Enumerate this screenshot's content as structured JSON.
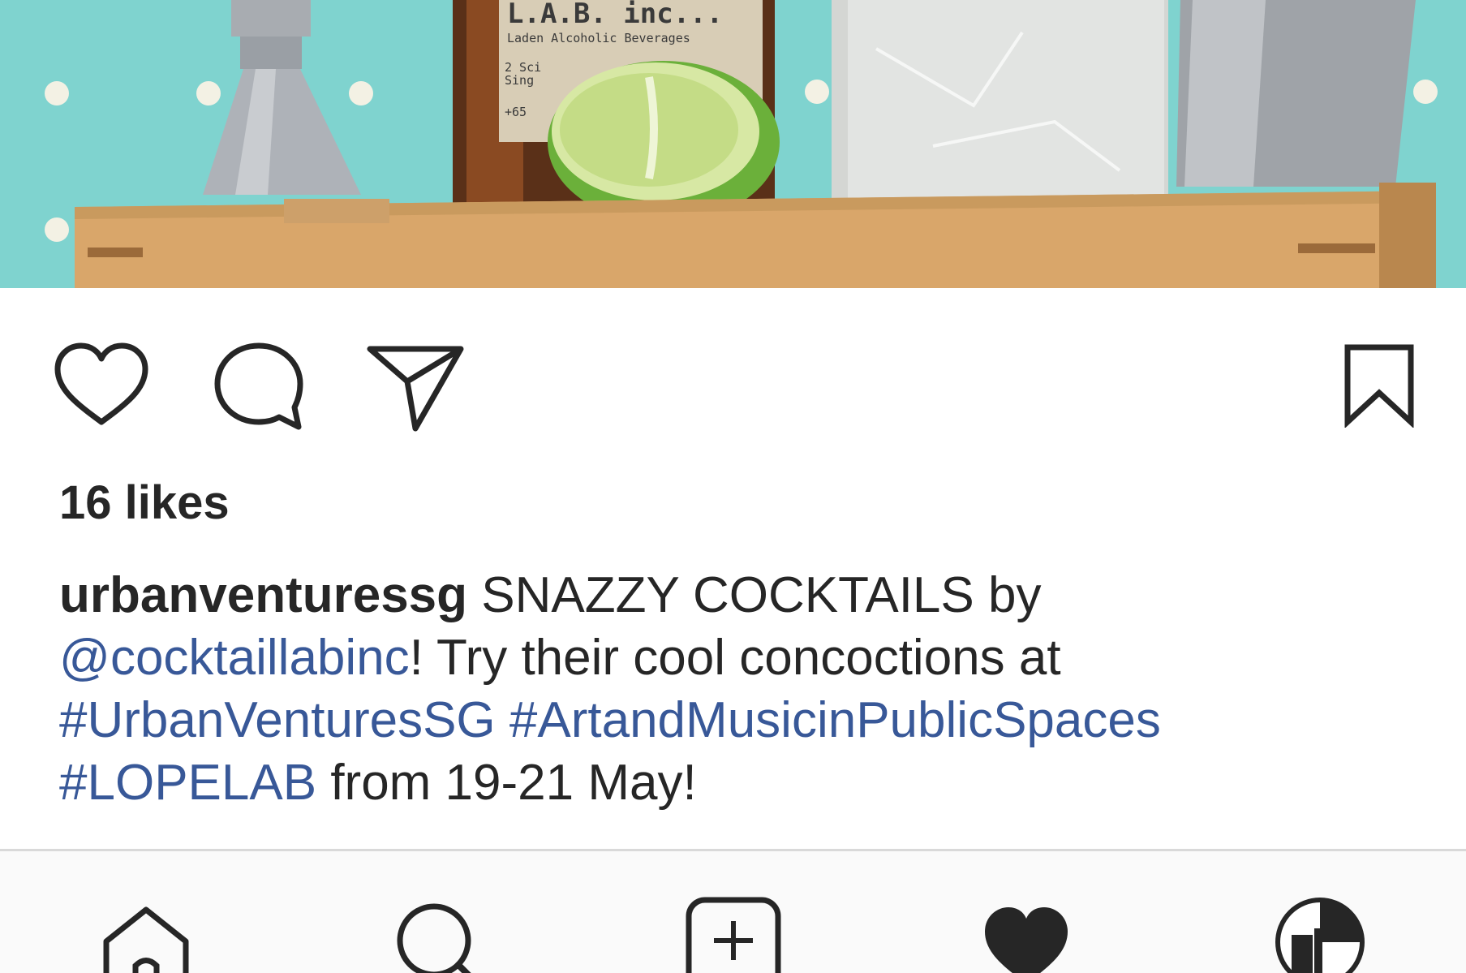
{
  "post": {
    "image": {
      "description_icon": "cocktail-product-photo",
      "bottle_label_title": "L.A.B. inc...",
      "bottle_label_subtitle": "Laden Alcoholic Beverages",
      "bottle_label_line3": "2 Sci",
      "bottle_label_line4": "Sing",
      "bottle_label_line5": "+65",
      "background_color": "#7fd3cf"
    },
    "actions": {
      "like_icon": "heart-outline-icon",
      "comment_icon": "speech-bubble-icon",
      "share_icon": "paper-plane-icon",
      "save_icon": "bookmark-icon"
    },
    "likes": "16 likes",
    "caption": {
      "username": "urbanventuressg",
      "text_1": " SNAZZY COCKTAILS by ",
      "mention": "@cocktaillabinc",
      "text_2": "! Try their cool concoctions at ",
      "hashtag_1": "#UrbanVenturesSG",
      "hashtag_2": "#ArtandMusicinPublicSpaces",
      "hashtag_3": "#LOPELAB",
      "text_3": " from 19-21 May!"
    }
  },
  "tab_bar": {
    "items": [
      {
        "icon": "home-icon"
      },
      {
        "icon": "search-icon"
      },
      {
        "icon": "add-post-icon"
      },
      {
        "icon": "activity-heart-icon"
      },
      {
        "icon": "profile-avatar-icon"
      }
    ]
  },
  "colors": {
    "link": "#385898",
    "text": "#262626",
    "teal_background": "#7fd3cf",
    "divider": "#d9d9d9"
  }
}
